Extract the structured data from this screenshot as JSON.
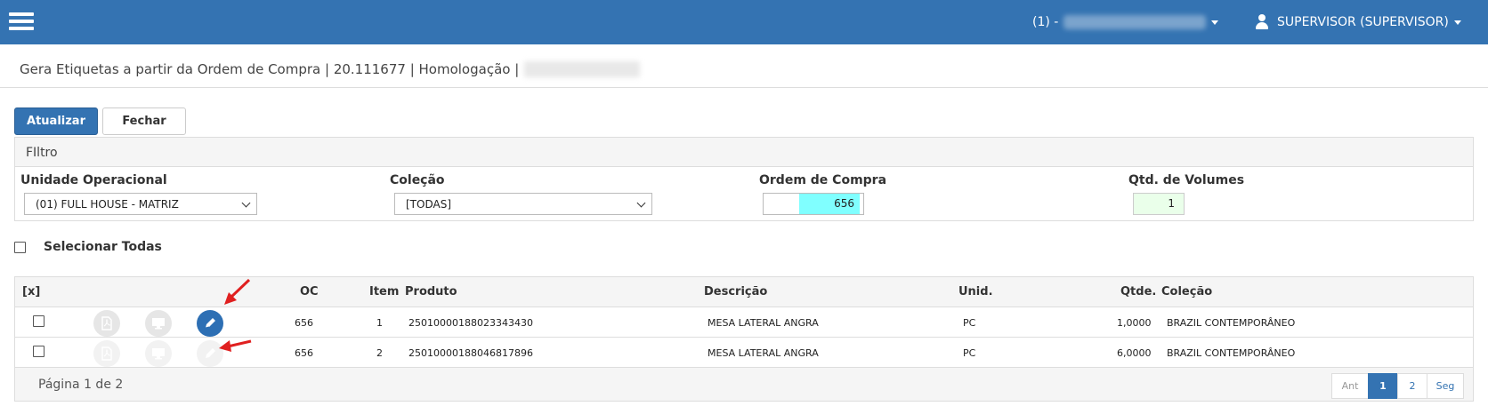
{
  "header": {
    "unit_prefix": "(1) -",
    "user_label": "SUPERVISOR (SUPERVISOR)"
  },
  "page": {
    "title": "Gera Etiquetas a partir da Ordem de Compra | 20.111677 | Homologação |"
  },
  "toolbar": {
    "update_label": "Atualizar",
    "close_label": "Fechar"
  },
  "filter": {
    "heading": "FIltro",
    "unit_label": "Unidade Operacional",
    "unit_value": "(01) FULL HOUSE - MATRIZ",
    "collection_label": "Coleção",
    "collection_value": "[TODAS]",
    "order_label": "Ordem de Compra",
    "order_value": "656",
    "volumes_label": "Qtd. de Volumes",
    "volumes_value": "1"
  },
  "select_all_label": "Selecionar Todas",
  "table": {
    "headers": {
      "select": "[x]",
      "oc": "OC",
      "item": "Item",
      "produto": "Produto",
      "descricao": "Descrição",
      "unid": "Unid.",
      "qtde": "Qtde.",
      "colecao": "Coleção"
    },
    "rows": [
      {
        "oc": "656",
        "item": "1",
        "produto": "25010000188023343430",
        "descricao": "MESA LATERAL ANGRA",
        "unid": "PC",
        "qtde": "1,0000",
        "colecao": "BRAZIL CONTEMPORÂNEO"
      },
      {
        "oc": "656",
        "item": "2",
        "produto": "25010000188046817896",
        "descricao": "MESA LATERAL ANGRA",
        "unid": "PC",
        "qtde": "6,0000",
        "colecao": "BRAZIL CONTEMPORÂNEO"
      }
    ],
    "icons": [
      "pdf-icon",
      "monitor-icon",
      "edit-icon"
    ],
    "page_info": "Página 1 de 2",
    "pager": {
      "prev": "Ant",
      "p1": "1",
      "p2": "2",
      "next": "Seg"
    }
  },
  "colors": {
    "primary": "#3473b2",
    "order_fill": "#80ffff",
    "volume_fill": "#eaffea",
    "arrow": "#e02020"
  }
}
